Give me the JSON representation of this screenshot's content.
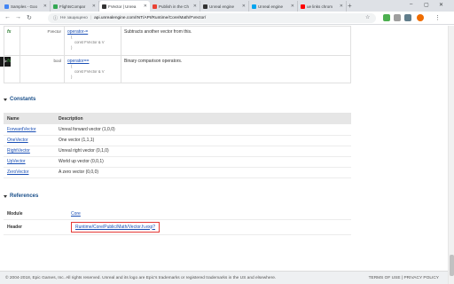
{
  "browser": {
    "tabs": [
      {
        "label": "Samples - Goo",
        "color": "#4285f4"
      },
      {
        "label": "FlightsCompar",
        "color": "#34a853"
      },
      {
        "label": "FVector | Unrea",
        "color": "#333333"
      },
      {
        "label": "Publish in the Ch",
        "color": "#ea4335"
      },
      {
        "label": "Unreal engine",
        "color": "#333333"
      },
      {
        "label": "Unreal engine",
        "color": "#00a4ef"
      },
      {
        "label": "ue links chrom",
        "color": "#ff0000"
      }
    ],
    "new_tab": "+",
    "window_controls": {
      "minimize": "–",
      "maximize": "▢",
      "close": "✕"
    },
    "security_label": "Не защищено",
    "url": "api.unrealengine.com/INT/API/Runtime/Core/Math/FVector/"
  },
  "functions": [
    {
      "icon": "fx",
      "return_type": "FVector",
      "name": "operator-=",
      "signature": [
        "(",
        "const FVector & V",
        ")"
      ],
      "description": "Subtracts another vector from this."
    },
    {
      "icon": "fx",
      "return_type": "bool",
      "name": "operator==",
      "signature": [
        "(",
        "const FVector & V",
        ")"
      ],
      "description": "Binary comparison operators."
    }
  ],
  "constants": {
    "title": "Constants",
    "columns": [
      "Name",
      "Description"
    ],
    "rows": [
      {
        "name": "ForwardVector",
        "description": "Unreal forward vector (1,0,0)"
      },
      {
        "name": "OneVector",
        "description": "One vector (1,1,1)"
      },
      {
        "name": "RightVector",
        "description": "Unreal right vector (0,1,0)"
      },
      {
        "name": "UpVector",
        "description": "World up vector (0,0,1)"
      },
      {
        "name": "ZeroVector",
        "description": "A zero vector (0,0,0)"
      }
    ]
  },
  "references": {
    "title": "References",
    "module_label": "Module",
    "module_value": "Core",
    "header_label": "Header",
    "header_value": "Runtime/Core/Public/Math/Vector.h.exp?"
  },
  "sidebar_toggle": ">",
  "footer": {
    "copyright": "© 2004-2018, Epic Games, Inc. All rights reserved. Unreal and its logo are Epic's trademarks or registered trademarks in the US and elsewhere.",
    "links": "TERMS OF USE | PRIVACY POLICY"
  }
}
